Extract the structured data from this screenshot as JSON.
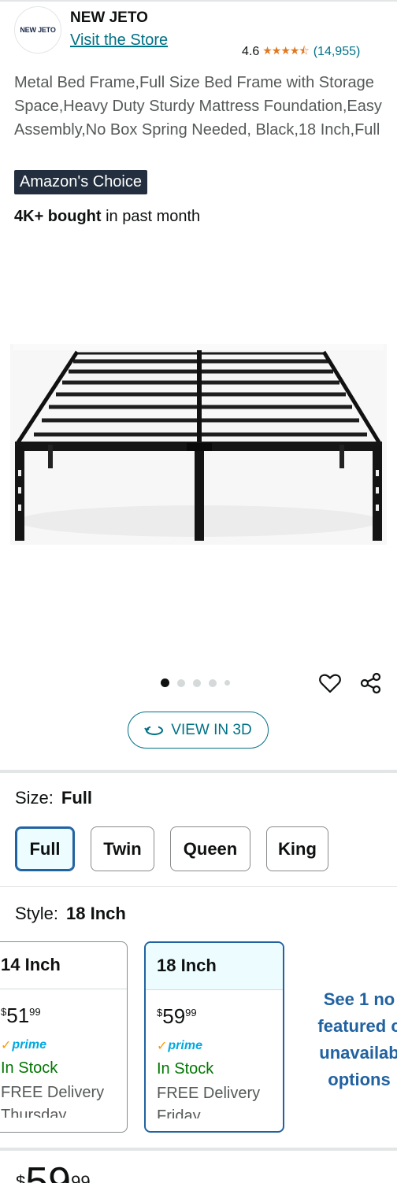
{
  "header": {
    "logo_text": "NEW JETO",
    "brand": "NEW JETO",
    "visit_store": "Visit the Store",
    "rating": "4.6",
    "stars_icon": "star-rating-icon",
    "review_count": "(14,955)"
  },
  "product": {
    "title": "Metal Bed Frame,Full Size Bed Frame with Storage Space,Heavy Duty Sturdy Mattress Foundation,Easy Assembly,No Box Spring Needed, Black,18 Inch,Full",
    "badge": "Amazon's Choice",
    "bought_bold": "4K+ bought",
    "bought_rest": "in past month",
    "image_count": 5,
    "active_image": 1
  },
  "actions": {
    "view3d_label": "VIEW IN 3D",
    "wishlist_icon": "heart-icon",
    "share_icon": "share-icon"
  },
  "size": {
    "label": "Size:",
    "selected": "Full",
    "options": [
      "Full",
      "Twin",
      "Queen",
      "King"
    ]
  },
  "style": {
    "label": "Style:",
    "selected": "18 Inch",
    "cards": [
      {
        "name": "14 Inch",
        "price_symbol": "$",
        "price_whole": "51",
        "price_fraction": "99",
        "prime": "prime",
        "stock": "In Stock",
        "delivery": "FREE Delivery",
        "delivery_day": "Thursday"
      },
      {
        "name": "18 Inch",
        "price_symbol": "$",
        "price_whole": "59",
        "price_fraction": "99",
        "prime": "prime",
        "stock": "In Stock",
        "delivery": "FREE Delivery",
        "delivery_day": "Friday"
      }
    ],
    "see_more": [
      "See 1 no",
      "featured c",
      "unavailab",
      "options"
    ]
  },
  "bottom": {
    "price_symbol": "$",
    "price_whole": "59",
    "price_fraction": "99"
  },
  "colors": {
    "link": "#007185",
    "selected_border": "#2162a1",
    "in_stock": "#007600",
    "badge_bg": "#232f3e",
    "star": "#de7921"
  }
}
